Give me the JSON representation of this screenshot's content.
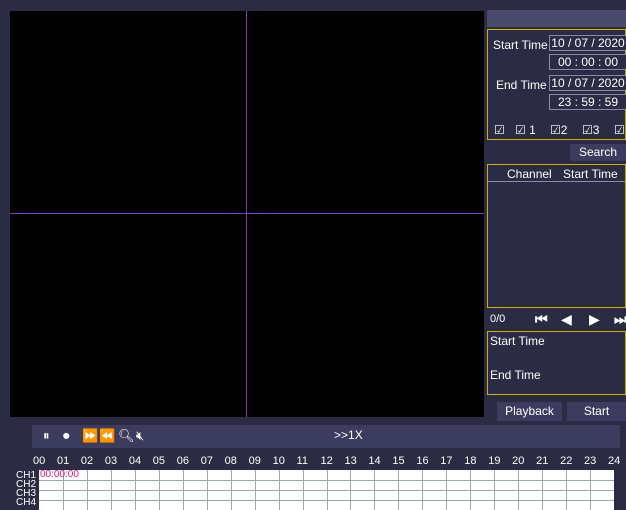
{
  "search": {
    "start_time_label": "Start Time",
    "start_date": "10 / 07 / 2020",
    "start_clock": "00 : 00 : 00",
    "end_time_label": "End Time",
    "end_date": "10 / 07 / 2020",
    "end_clock": "23 : 59 : 59",
    "channels": [
      "",
      "1",
      "2",
      "3",
      ""
    ],
    "search_label": "Search"
  },
  "results": {
    "columns": [
      "Channel",
      "Start Time"
    ],
    "page": "0/0"
  },
  "info": {
    "start_time_label": "Start Time",
    "end_time_label": "End Time"
  },
  "buttons": {
    "playback": "Playback",
    "start": "Start"
  },
  "controls": {
    "speed": ">>1X"
  },
  "timeline": {
    "hours": [
      "00",
      "01",
      "02",
      "03",
      "04",
      "05",
      "06",
      "07",
      "08",
      "09",
      "10",
      "11",
      "12",
      "13",
      "14",
      "15",
      "16",
      "17",
      "18",
      "19",
      "20",
      "21",
      "22",
      "23",
      "24"
    ],
    "channels": [
      "CH1",
      "CH2",
      "CH3",
      "CH4"
    ],
    "current_time": "00:00:00"
  },
  "colors": {
    "accent_border": "#c9b400",
    "split_line": "#7a3fb6",
    "time_marker": "#e0157a"
  }
}
